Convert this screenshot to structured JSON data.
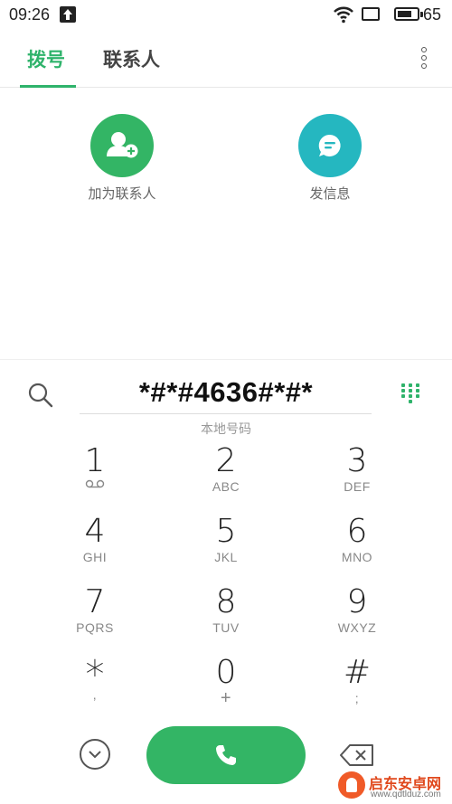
{
  "status_bar": {
    "time": "09:26",
    "battery": "65"
  },
  "tabs": [
    {
      "label": "拨号",
      "active": true
    },
    {
      "label": "联系人",
      "active": false
    }
  ],
  "actions": {
    "add_contact": {
      "label": "加为联系人",
      "icon": "add-contact-icon",
      "color": "#33b565"
    },
    "send_message": {
      "label": "发信息",
      "icon": "message-icon",
      "color": "#25b7c0"
    }
  },
  "dialer": {
    "number": "*#*#4636#*#*",
    "hint": "本地号码"
  },
  "keypad": [
    {
      "digit": "1",
      "letters": ""
    },
    {
      "digit": "2",
      "letters": "ABC"
    },
    {
      "digit": "3",
      "letters": "DEF"
    },
    {
      "digit": "4",
      "letters": "GHI"
    },
    {
      "digit": "5",
      "letters": "JKL"
    },
    {
      "digit": "6",
      "letters": "MNO"
    },
    {
      "digit": "7",
      "letters": "PQRS"
    },
    {
      "digit": "8",
      "letters": "TUV"
    },
    {
      "digit": "9",
      "letters": "WXYZ"
    },
    {
      "digit": "*",
      "letters": ","
    },
    {
      "digit": "0",
      "letters": "+"
    },
    {
      "digit": "#",
      "letters": ";"
    }
  ],
  "watermark": {
    "title": "启东安卓网",
    "url": "www.qdtlduz.com"
  },
  "colors": {
    "accent": "#2fb36b",
    "call": "#33b565",
    "message": "#25b7c0"
  }
}
